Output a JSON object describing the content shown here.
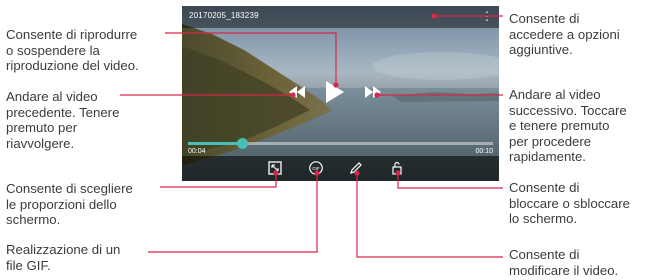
{
  "video": {
    "filename": "20170205_183239",
    "current_time": "00:04",
    "total_time": "00:10",
    "progress": 0.18
  },
  "icons": {
    "menu": "more-vertical-icon",
    "rewind": "rewind-icon",
    "play": "play-icon",
    "forward": "fast-forward-icon",
    "ratio": "aspect-ratio-icon",
    "gif": "gif-icon",
    "edit": "pencil-icon",
    "lock": "lock-icon"
  },
  "colors": {
    "callout_line": "#d9264a",
    "accent": "#49c0b6"
  },
  "callouts": {
    "play_pause": [
      "Consente di riprodurre",
      "o sospendere la",
      "riproduzione del video."
    ],
    "previous": [
      "Andare al video",
      "precedente. Tenere",
      "premuto per",
      "riavvolgere."
    ],
    "ratio": [
      "Consente di scegliere",
      "le proporzioni dello",
      "schermo."
    ],
    "gif": [
      "Realizzazione di un",
      "file GIF."
    ],
    "options": [
      "Consente di",
      "accedere a opzioni",
      "aggiuntive."
    ],
    "next": [
      "Andare al video",
      "successivo. Toccare",
      "e tenere premuto",
      "per procedere",
      "rapidamente."
    ],
    "lock": [
      "Consente di",
      "bloccare o sbloccare",
      "lo schermo."
    ],
    "edit": [
      "Consente di",
      "modificare il video."
    ]
  }
}
